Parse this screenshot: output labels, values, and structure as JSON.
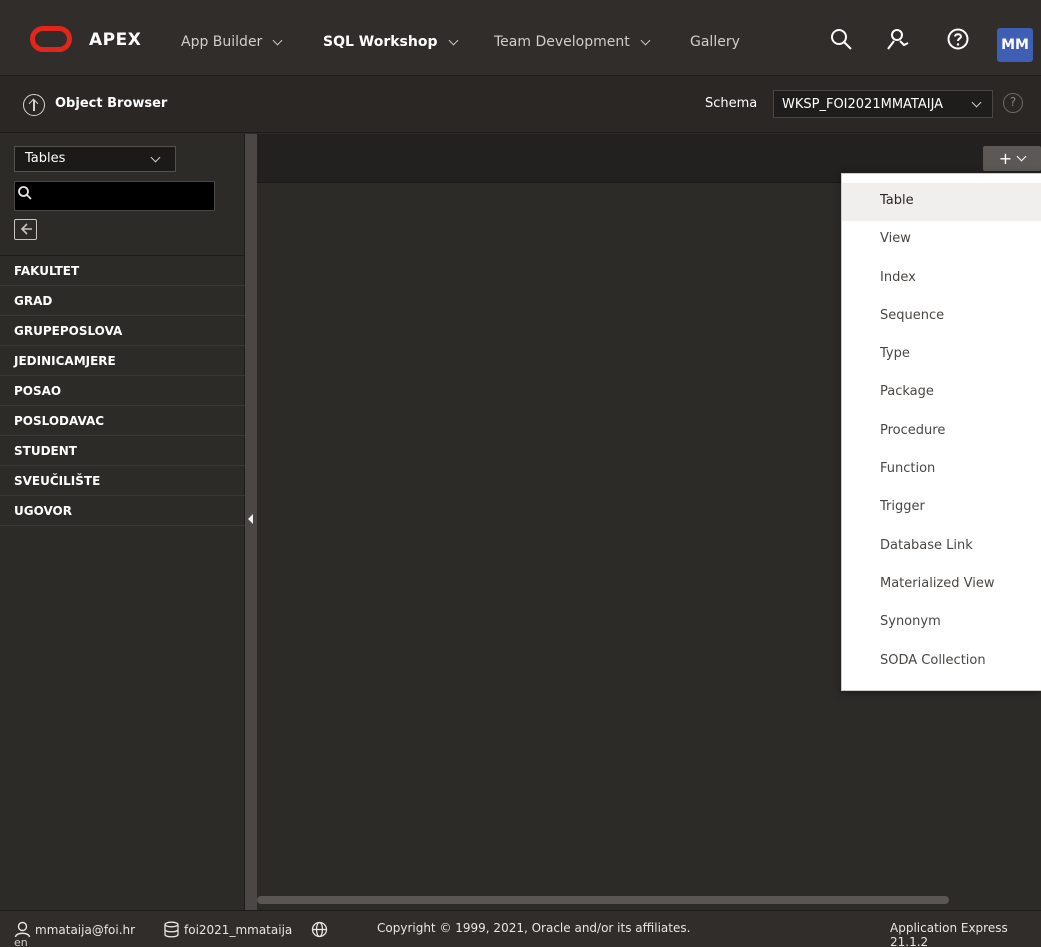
{
  "header": {
    "brand": "APEX",
    "nav": [
      {
        "label": "App Builder",
        "has_menu": true,
        "active": false
      },
      {
        "label": "SQL Workshop",
        "has_menu": true,
        "active": true
      },
      {
        "label": "Team Development",
        "has_menu": true,
        "active": false
      },
      {
        "label": "Gallery",
        "has_menu": false,
        "active": false
      }
    ],
    "icons": [
      "search-icon",
      "admin-user-icon",
      "help-icon"
    ],
    "avatar": "MM",
    "colors": {
      "bar": "#312d2a",
      "logo": "#e2261c",
      "avatar": "#3f5fb4"
    }
  },
  "subheader": {
    "title": "Object Browser",
    "schema_label": "Schema",
    "schema_value": "WKSP_FOI2021MMATAIJA",
    "help_glyph": "?"
  },
  "left_panel": {
    "object_type": "Tables",
    "search_value": "",
    "tables": [
      "FAKULTET",
      "GRAD",
      "GRUPEPOSLOVA",
      "JEDINICAMJERE",
      "POSAO",
      "POSLODAVAC",
      "STUDENT",
      "SVEUČILIŠTE",
      "UGOVOR"
    ]
  },
  "toolbar": {
    "create_label": "+"
  },
  "create_menu": {
    "items": [
      "Table",
      "View",
      "Index",
      "Sequence",
      "Type",
      "Package",
      "Procedure",
      "Function",
      "Trigger",
      "Database Link",
      "Materialized View",
      "Synonym",
      "SODA Collection"
    ],
    "highlighted": "Table"
  },
  "footer": {
    "user": "mmataija@foi.hr",
    "workspace": "foi2021_mmataija",
    "copyright": "Copyright © 1999, 2021, Oracle and/or its affiliates.",
    "version": "Application Express 21.1.2",
    "language": "en"
  }
}
